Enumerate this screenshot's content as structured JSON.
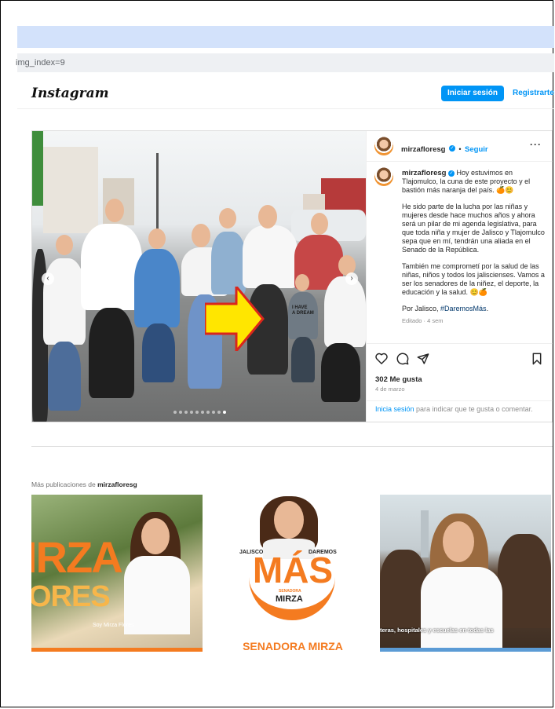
{
  "browser": {
    "url_fragment": "img_index=9"
  },
  "header": {
    "logo": "Instagram",
    "login_label": "Iniciar sesión",
    "register_label": "Registrarte"
  },
  "post": {
    "username": "mirzafloresg",
    "follow_separator": "•",
    "follow_label": "Seguir",
    "more_label": "···",
    "caption_paragraphs": [
      "Hoy estuvimos en Tlajomulco, la cuna de este proyecto y el bastión más naranja del país. 🍊😊",
      "He sido parte de la lucha por las niñas y mujeres desde hace muchos años y ahora será un pilar de mi agenda legislativa, para que toda niña y mujer de Jalisco y Tlajomulco sepa que en mí, tendrán una aliada en el Senado de la República.",
      "También me comprometí por la salud de las niñas, niños y todos los jaliscienses. Vamos a ser los senadores de la niñez, el deporte, la educación y la salud. 😊🍊"
    ],
    "closing_prefix": "Por Jalisco, ",
    "closing_tag": "#DaremosMás",
    "closing_suffix": ".",
    "edited_label": "Editado · 4 sem",
    "likes": "302 Me gusta",
    "date": "4 de marzo",
    "login_link": "Inicia sesión",
    "login_note": " para indicar que te gusta o comentar.",
    "carousel": {
      "total": 10,
      "active_index": 9
    },
    "photo_sign_text": "I HAVE\nA DREAM"
  },
  "more_posts": {
    "prefix": "Más publicaciones de ",
    "username": "mirzafloresg",
    "thumbs": [
      {
        "big_text_1": "IRZA",
        "big_text_2": "ORES",
        "small_text": "Soy Mirza Flores"
      },
      {
        "left_label": "JALISCO",
        "right_label": "DAREMOS",
        "mas_label": "MÁS",
        "senadora_small": "SENADORA",
        "mirza_label": "MIRZA",
        "bottom_label": "SENADORA MIRZA"
      },
      {
        "overlay_text": "teras, hospitales y escuelas en todas las"
      }
    ]
  },
  "colors": {
    "primary_blue": "#0095f6",
    "brand_orange": "#f47b20",
    "arrow_yellow": "#ffe600",
    "arrow_red": "#d9261c"
  }
}
